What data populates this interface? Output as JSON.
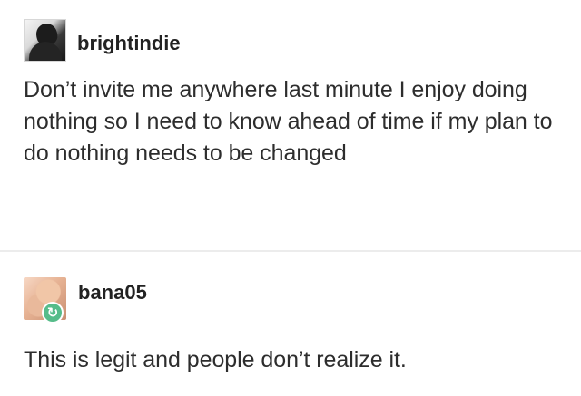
{
  "posts": [
    {
      "username": "brightindie",
      "text": "Don’t invite me anywhere last minute I enjoy doing nothing so I need to know ahead of time if my plan to do nothing needs to be changed",
      "avatar": "profile-silhouette-icon"
    },
    {
      "username": "bana05",
      "text": "This is legit and people don’t realize it.",
      "avatar": "profile-photo-avatar",
      "badge": "reblog-icon",
      "badge_color": "#56bc8a"
    }
  ]
}
